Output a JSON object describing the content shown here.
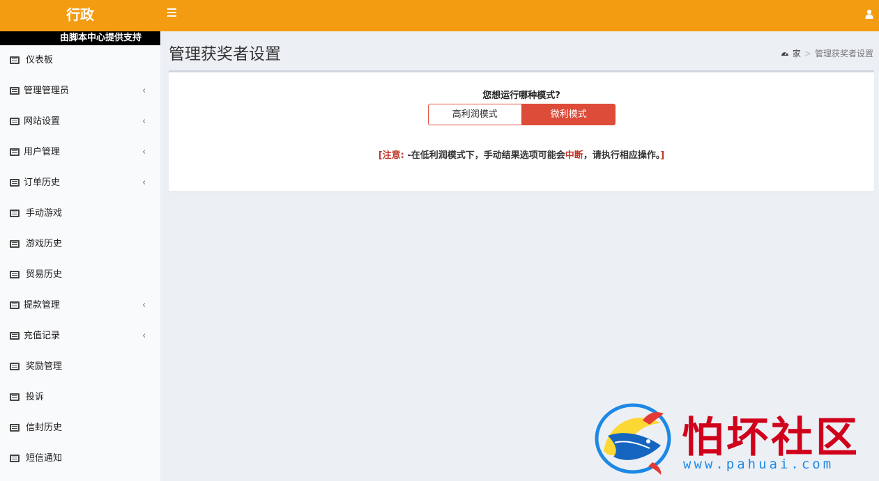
{
  "header": {
    "logo": "行政",
    "menu_toggle_icon": "hamburger-icon",
    "user_icon": "user-icon",
    "bg_color": "#f39c12"
  },
  "sidebar": {
    "support_text": "由脚本中心提供支持",
    "items": [
      {
        "label": "仪表板",
        "icon": "list-icon",
        "submenu": false
      },
      {
        "label": "管理管理员",
        "icon": "list-icon",
        "submenu": true
      },
      {
        "label": "网站设置",
        "icon": "list-icon",
        "submenu": true
      },
      {
        "label": "用户管理",
        "icon": "list-icon",
        "submenu": true
      },
      {
        "label": "订单历史",
        "icon": "list-icon",
        "submenu": true
      },
      {
        "label": "手动游戏",
        "icon": "list-icon",
        "submenu": false
      },
      {
        "label": "游戏历史",
        "icon": "list-icon",
        "submenu": false
      },
      {
        "label": "贸易历史",
        "icon": "list-icon",
        "submenu": false
      },
      {
        "label": "提款管理",
        "icon": "list-icon",
        "submenu": true
      },
      {
        "label": "充值记录",
        "icon": "list-icon",
        "submenu": true
      },
      {
        "label": "奖励管理",
        "icon": "list-icon",
        "submenu": false
      },
      {
        "label": "投诉",
        "icon": "list-icon",
        "submenu": false
      },
      {
        "label": "信封历史",
        "icon": "list-icon",
        "submenu": false
      },
      {
        "label": "短信通知",
        "icon": "list-icon",
        "submenu": false
      }
    ],
    "chevron": "‹"
  },
  "page": {
    "title": "管理获奖者设置",
    "breadcrumb": {
      "home": "家",
      "separator": ">",
      "current": "管理获奖者设置"
    }
  },
  "mode_box": {
    "question": "您想运行哪种模式?",
    "options": [
      "高利润模式",
      "微利模式"
    ],
    "selected": "微利模式",
    "notice": {
      "open": "[",
      "label": "注意:",
      "text_before": " -在低利润模式下，手动结果选项可能会",
      "highlight": "中断",
      "text_after": "，请执行相应操作。",
      "close": "]"
    }
  },
  "watermark": {
    "title": "怕坏社区",
    "url": "www.pahuai.com",
    "logo_icon": "fish-logo-icon"
  },
  "colors": {
    "accent": "#f39c12",
    "danger": "#dd4b39",
    "notice_red": "#c0392b"
  }
}
